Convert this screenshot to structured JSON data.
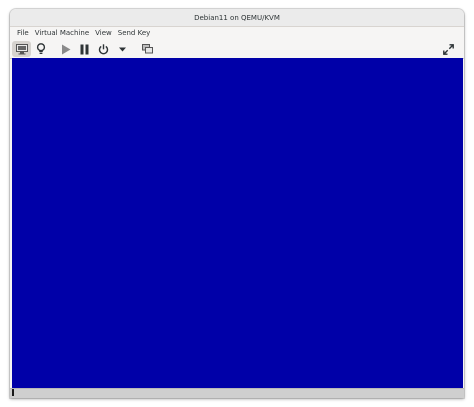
{
  "window": {
    "title": "Debian11 on QEMU/KVM"
  },
  "menubar": {
    "items": [
      "File",
      "Virtual Machine",
      "View",
      "Send Key"
    ]
  },
  "toolbar": {
    "buttons": [
      {
        "icon": "monitor-icon",
        "active": true
      },
      {
        "icon": "lightbulb-icon",
        "active": false
      },
      {
        "icon": "play-icon",
        "active": false
      },
      {
        "icon": "pause-icon",
        "active": false
      },
      {
        "icon": "power-icon",
        "active": false
      },
      {
        "icon": "chevron-down-icon",
        "active": false
      },
      {
        "icon": "snapshots-icon",
        "active": false
      },
      {
        "icon": "fullscreen-icon",
        "active": false
      }
    ]
  },
  "display": {
    "background": "#0000a8"
  }
}
